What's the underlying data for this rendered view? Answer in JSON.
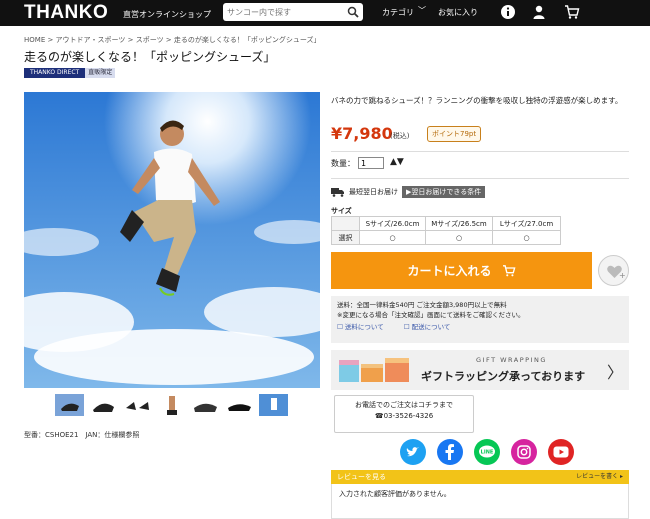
{
  "header": {
    "logo": "THANKO",
    "logo_sub": "直営オンラインショップ",
    "search_placeholder": "サンコー内で探す",
    "nav_category": "カテゴリ",
    "nav_chevron": "﹀",
    "nav_favorites": "お気に入り",
    "icons": [
      "search-icon",
      "info-icon",
      "user-icon",
      "cart-icon"
    ]
  },
  "breadcrumb": "HOME > アウトドア・スポーツ > スポーツ > 走るのが楽しくなる！「ポッピングシューズ」",
  "product": {
    "title": "走るのが楽しくなる！「ポッピングシューズ」",
    "badge_brand": "THANKO DIRECT",
    "badge_exclusive": "直販限定",
    "model": "型番：CSHOE21　JAN：仕様欄参照",
    "description": "バネの力で跳ねるシューズ！？ランニングの衝撃を吸収し独特の浮遊感が楽しめます。",
    "price": "¥7,980",
    "price_tax": "(税込)",
    "points": "ポイント79pt",
    "qty_label": "数量：",
    "qty_value": "1",
    "qty_arrows": "▲▼",
    "delivery_label": "最短翌日お届け",
    "delivery_condition": "▶翌日お届けできる条件",
    "size_label": "サイズ",
    "sizes": [
      "Sサイズ/26.0cm",
      "Mサイズ/26.5cm",
      "Lサイズ/27.0cm"
    ],
    "size_select_label": "選択",
    "size_radio": "○",
    "cart_button": "カートに入れる",
    "shipping_line1": "送料：全国一律料金540円 ご注文金額3,980円以上で無料",
    "shipping_line2": "※変更になる場合「注文確認」画面にて送料をご確認ください。",
    "shipping_link": "送料について",
    "delivery_link": "配送について",
    "gift_en": "GIFT WRAPPING",
    "gift_jp": "ギフトラッピング承っております",
    "gift_chevron": "〉",
    "phone_line1": "お電話でのご注文はコチラまで",
    "phone_line2": "☎03-3526-4326",
    "social": [
      "twitter-icon",
      "facebook-icon",
      "line-icon",
      "instagram-icon",
      "youtube-icon"
    ],
    "social_line_text": "LINE",
    "review_header": "レビューを見る",
    "review_more": "レビューを書く ▸",
    "review_empty": "入力された顧客評価がありません。"
  },
  "colors": {
    "header_bg": "#111111",
    "price": "#d4370d",
    "cart": "#f5950f",
    "review_bar": "#f2c318"
  }
}
